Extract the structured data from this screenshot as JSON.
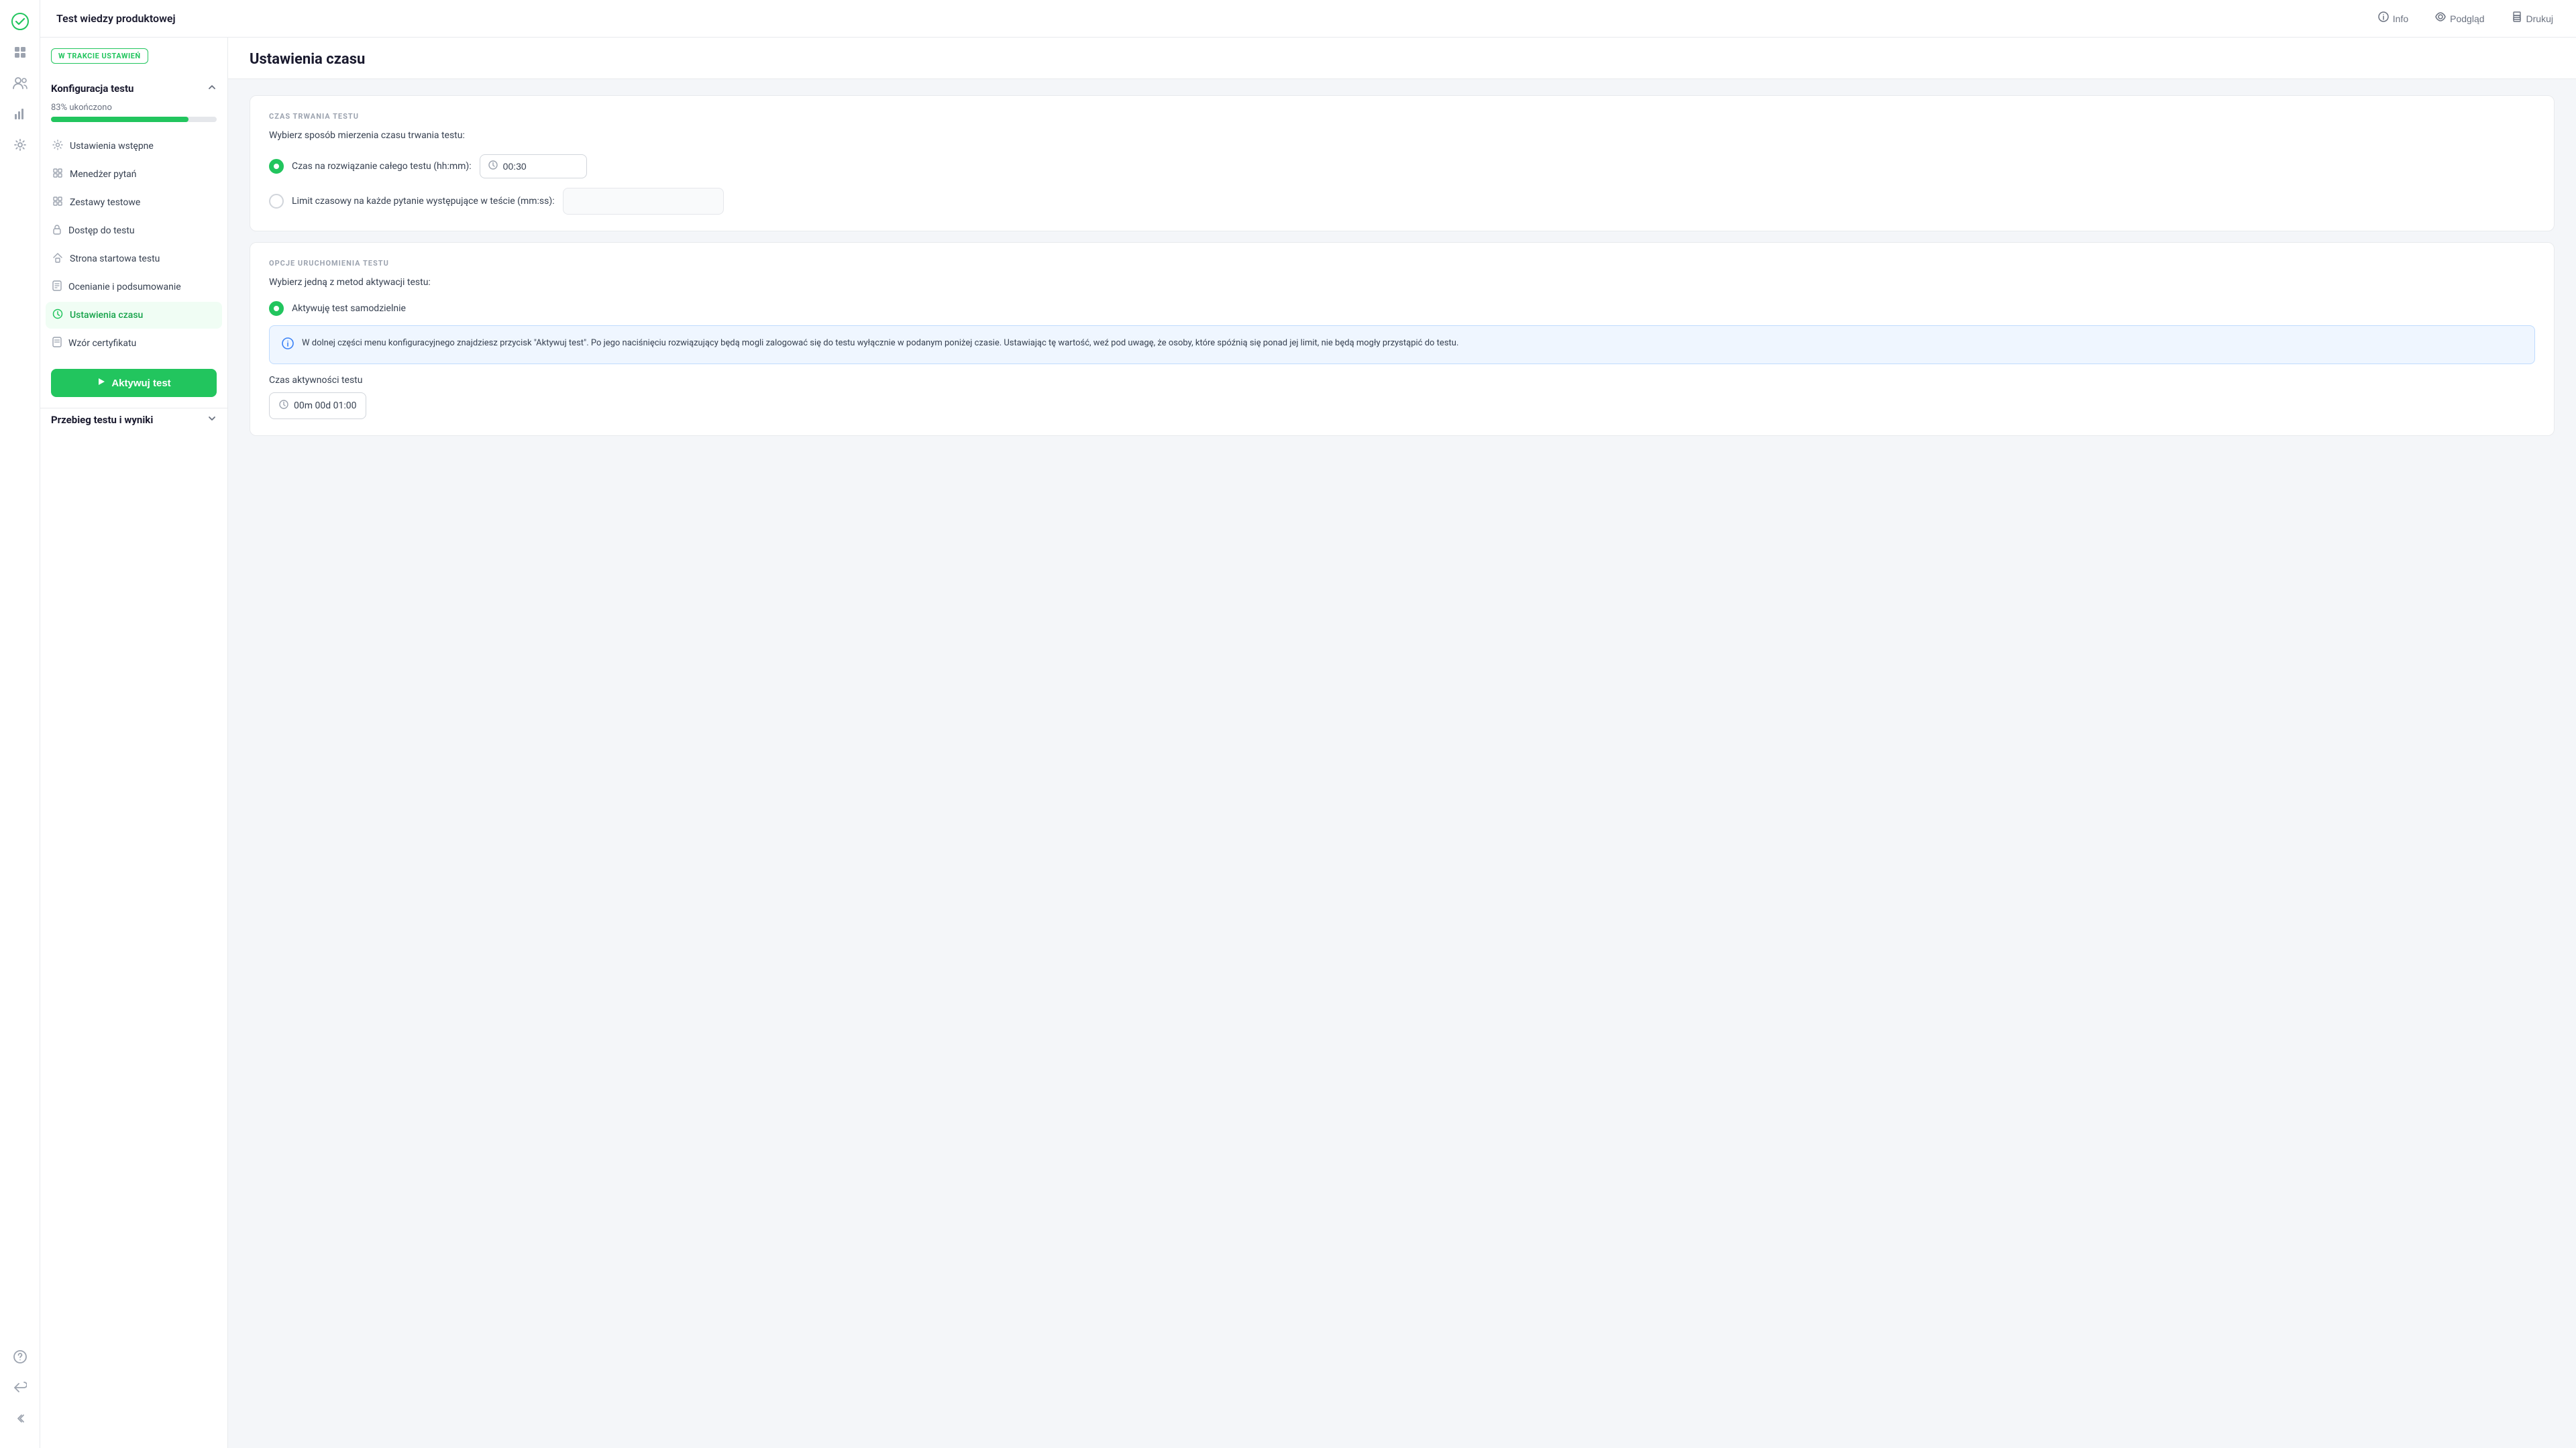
{
  "app": {
    "logo_icon": "✓",
    "page_title": "Test wiedzy produktowej",
    "header_actions": [
      {
        "id": "info",
        "icon": "ℹ",
        "label": "Info"
      },
      {
        "id": "podglad",
        "icon": "👁",
        "label": "Podgląd"
      },
      {
        "id": "drukuj",
        "icon": "🖨",
        "label": "Drukuj"
      }
    ]
  },
  "sidebar": {
    "status_badge": "W TRAKCIE USTAWIEŃ",
    "config_section_title": "Konfiguracja testu",
    "progress_label": "83% ukończono",
    "progress_percent": 83,
    "nav_items": [
      {
        "id": "ustawienia-wstepne",
        "icon": "⚙",
        "label": "Ustawienia wstępne",
        "active": false
      },
      {
        "id": "menedzer-pytan",
        "icon": "⚡",
        "label": "Menedżer pytań",
        "active": false
      },
      {
        "id": "zestawy-testowe",
        "icon": "▦",
        "label": "Zestawy testowe",
        "active": false
      },
      {
        "id": "dostep-do-testu",
        "icon": "🔒",
        "label": "Dostęp do testu",
        "active": false
      },
      {
        "id": "strona-startowa",
        "icon": "🏠",
        "label": "Strona startowa testu",
        "active": false
      },
      {
        "id": "ocenianie",
        "icon": "📋",
        "label": "Ocenianie i podsumowanie",
        "active": false
      },
      {
        "id": "ustawienia-czasu",
        "icon": "🕐",
        "label": "Ustawienia czasu",
        "active": true
      },
      {
        "id": "wzor-certyfikatu",
        "icon": "📄",
        "label": "Wzór certyfikatu",
        "active": false
      }
    ],
    "activate_btn_label": "Aktywuj test",
    "activate_btn_icon": "▶",
    "results_section_title": "Przebieg testu i wyniki"
  },
  "main": {
    "page_heading": "Ustawienia czasu",
    "section1": {
      "label": "CZAS TRWANIA TESTU",
      "subtitle": "Wybierz sposób mierzenia czasu trwania testu:",
      "options": [
        {
          "id": "caly-test",
          "label": "Czas na rozwiązanie całego testu (hh:mm):",
          "selected": true,
          "time_value": "00:30"
        },
        {
          "id": "na-pytanie",
          "label": "Limit czasowy na każde pytanie występujące w teście (mm:ss):",
          "selected": false,
          "time_value": ""
        }
      ]
    },
    "section2": {
      "label": "OPCJE URUCHOMIENIA TESTU",
      "subtitle": "Wybierz jedną z metod aktywacji testu:",
      "options": [
        {
          "id": "samodzielnie",
          "label": "Aktywuję test samodzielnie",
          "selected": true
        }
      ],
      "info_text": "W dolnej części menu konfiguracyjnego znajdziesz przycisk \"Aktywuj test\". Po jego naciśnięciu rozwiązujący będą mogli zalogować się do testu wyłącznie w podanym poniżej czasie. Ustawiając tę wartość, weź pod uwagę, że osoby, które spóźnią się ponad jej limit, nie będą mogły przystąpić do testu.",
      "time_activity_label": "Czas aktywności testu",
      "time_activity_value": "00m 00d 01:00"
    }
  },
  "left_nav": {
    "items": [
      {
        "id": "logo",
        "icon": "✓",
        "active": true
      },
      {
        "id": "grid",
        "icon": "⊞",
        "active": false
      },
      {
        "id": "users",
        "icon": "👥",
        "active": false
      },
      {
        "id": "chart",
        "icon": "📊",
        "active": false
      },
      {
        "id": "settings",
        "icon": "⚙",
        "active": false
      }
    ],
    "bottom_items": [
      {
        "id": "help",
        "icon": "?"
      },
      {
        "id": "back",
        "icon": "↩"
      },
      {
        "id": "collapse",
        "icon": "«"
      }
    ]
  }
}
